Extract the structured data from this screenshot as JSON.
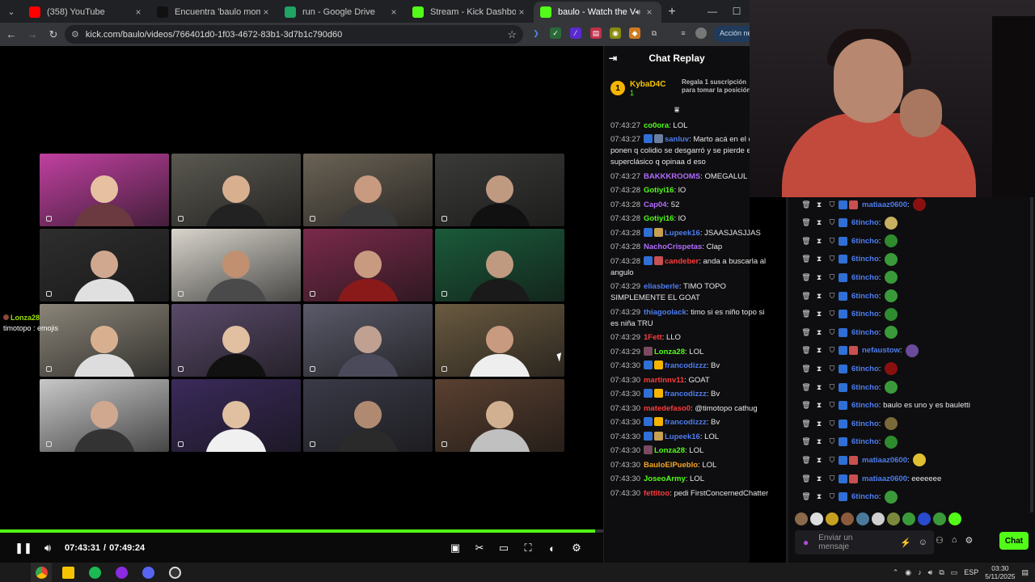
{
  "tabs": [
    {
      "label": "(358) YouTube",
      "favicon_color": "#ff0000"
    },
    {
      "label": "Encuentra 'baulo momo' en TikTok",
      "favicon_color": "#111111"
    },
    {
      "label": "run - Google Drive",
      "favicon_color": "#1fa463"
    },
    {
      "label": "Stream - Kick Dashboard",
      "favicon_color": "#53fc18"
    },
    {
      "label": "baulo - Watch the VOD on Kick",
      "favicon_color": "#53fc18",
      "active": true
    }
  ],
  "address": {
    "url": "kick.com/baulo/videos/766401d0-1f03-4672-83b1-3d7b1c790d60",
    "action_label": "Acción necesaria"
  },
  "player": {
    "time_current": "07:43:31",
    "time_separator": "/",
    "time_total": "07:49:24",
    "progress": 0.987,
    "overlay": {
      "user": "Lonza28",
      "line2": "timotopo : emojis"
    }
  },
  "chat_replay": {
    "title": "Chat Replay",
    "pinned": {
      "rank": "1",
      "user": "KybaD4C",
      "sub_count": "1",
      "gift_line1": "Regala 1 suscripción",
      "gift_line2": "para tomar la posición"
    },
    "messages": [
      {
        "ts": "07:43:27",
        "user": "co0ora",
        "color": "#53fc18",
        "text": "LOL"
      },
      {
        "ts": "07:43:27",
        "user": "sanluv",
        "color": "#4d7df0",
        "text": "Marto acá en el chat ponen q colidio se desgarró y se pierde el superclásico q opinaa d eso",
        "badges": [
          "#2f6fd6",
          "#6a7fa0"
        ]
      },
      {
        "ts": "07:43:27",
        "user": "BAKKKROOMS",
        "color": "#b36bff",
        "text": "OMEGALUL"
      },
      {
        "ts": "07:43:28",
        "user": "Gotiyi16",
        "color": "#53fc18",
        "text": "lO"
      },
      {
        "ts": "07:43:28",
        "user": "Cap04",
        "color": "#b36bff",
        "text": "52"
      },
      {
        "ts": "07:43:28",
        "user": "Gotiyi16",
        "color": "#53fc18",
        "text": "lO"
      },
      {
        "ts": "07:43:28",
        "user": "Lupeek16",
        "color": "#4d7df0",
        "text": "JSAASJASJJAS",
        "badges": [
          "#2f6fd6",
          "#c8a050"
        ]
      },
      {
        "ts": "07:43:28",
        "user": "NachoCrispetas",
        "color": "#b36bff",
        "text": "Clap"
      },
      {
        "ts": "07:43:28",
        "user": "candeber",
        "color": "#ff3b3b",
        "text": "anda a buscarla al angulo",
        "badges": [
          "#2f6fd6",
          "#c85050"
        ]
      },
      {
        "ts": "07:43:29",
        "user": "eliasberle",
        "color": "#4d7df0",
        "text": "TIMO TOPO SIMPLEMENTE EL GOAT"
      },
      {
        "ts": "07:43:29",
        "user": "thiagoolack",
        "color": "#4d7df0",
        "text": "timo si es niño topo si es niña TRU"
      },
      {
        "ts": "07:43:29",
        "user": "1Fett",
        "color": "#ff3b3b",
        "text": "LLO"
      },
      {
        "ts": "07:43:29",
        "user": "Lonza28",
        "color": "#53fc18",
        "text": "LOL",
        "badges": [
          "#7a4a60"
        ]
      },
      {
        "ts": "07:43:30",
        "user": "francodizzz",
        "color": "#4d7df0",
        "text": "Bv",
        "badges": [
          "#2f6fd6",
          "#f5b400"
        ]
      },
      {
        "ts": "07:43:30",
        "user": "martinnv11",
        "color": "#ff3b3b",
        "text": "GOAT"
      },
      {
        "ts": "07:43:30",
        "user": "francodizzz",
        "color": "#4d7df0",
        "text": "Bv",
        "badges": [
          "#2f6fd6",
          "#f5b400"
        ]
      },
      {
        "ts": "07:43:30",
        "user": "matedefaso0",
        "color": "#ff3b3b",
        "text": "@timotopo cathug"
      },
      {
        "ts": "07:43:30",
        "user": "francodizzz",
        "color": "#4d7df0",
        "text": "Bv",
        "badges": [
          "#2f6fd6",
          "#f5b400"
        ]
      },
      {
        "ts": "07:43:30",
        "user": "Lupeek16",
        "color": "#4d7df0",
        "text": "LOL",
        "badges": [
          "#2f6fd6",
          "#c8a050"
        ]
      },
      {
        "ts": "07:43:30",
        "user": "Lonza28",
        "color": "#53fc18",
        "text": "LOL",
        "badges": [
          "#7a4a60"
        ]
      },
      {
        "ts": "07:43:30",
        "user": "BauloElPueblo",
        "color": "#f5a623",
        "text": "LOL"
      },
      {
        "ts": "07:43:30",
        "user": "JoseoArmy",
        "color": "#53fc18",
        "text": "LOL"
      },
      {
        "ts": "07:43:30",
        "user": "fettitoo",
        "color": "#ff3b3b",
        "text": "pedi FirstConcernedChatter"
      }
    ]
  },
  "side_chat": {
    "rows": [
      {
        "user": "matiaaz0600",
        "color": "#4d7df0",
        "text": "",
        "badge": "#c85050",
        "emote": "#8a1010"
      },
      {
        "user": "6tincho",
        "color": "#4d7df0",
        "text": "",
        "emote": "#c8b060"
      },
      {
        "user": "6tincho",
        "color": "#4d7df0",
        "text": "",
        "emote": "#2e8b2e"
      },
      {
        "user": "6tincho",
        "color": "#4d7df0",
        "text": "",
        "emote": "#3a9a3a"
      },
      {
        "user": "6tincho",
        "color": "#4d7df0",
        "text": "",
        "emote": "#3a9a3a"
      },
      {
        "user": "6tincho",
        "color": "#4d7df0",
        "text": "",
        "emote": "#3a9a3a"
      },
      {
        "user": "6tincho",
        "color": "#4d7df0",
        "text": "",
        "emote": "#2e8b2e"
      },
      {
        "user": "6tincho",
        "color": "#4d7df0",
        "text": "",
        "emote": "#3a9a3a"
      },
      {
        "user": "nefaustow",
        "color": "#4d7df0",
        "text": "",
        "badge": "#c85050",
        "emote": "#6a4a9a"
      },
      {
        "user": "6tincho",
        "color": "#4d7df0",
        "text": "",
        "emote": "#8a1010"
      },
      {
        "user": "6tincho",
        "color": "#4d7df0",
        "text": "",
        "emote": "#3a9a3a"
      },
      {
        "user": "6tincho",
        "color": "#4d7df0",
        "text": "baulo es uno y es bauletti",
        "emote": ""
      },
      {
        "user": "6tincho",
        "color": "#4d7df0",
        "text": "",
        "emote": "#7a6a3a"
      },
      {
        "user": "6tincho",
        "color": "#4d7df0",
        "text": "",
        "emote": "#2e8b2e"
      },
      {
        "user": "matiaaz0600",
        "color": "#4d7df0",
        "text": "",
        "badge": "#c85050",
        "emote": "#e0c030"
      },
      {
        "user": "matiaaz0600",
        "color": "#4d7df0",
        "text": "eeeeeee",
        "badge": "#c85050",
        "emote": ""
      },
      {
        "user": "6tincho",
        "color": "#4d7df0",
        "text": "",
        "emote": "#3a9a3a"
      }
    ],
    "input_placeholder_1": "Enviar un",
    "input_placeholder_2": "mensaje",
    "chat_button": "Chat"
  },
  "taskbar": {
    "lang": "ESP",
    "time": "03:30",
    "date": "5/11/2025"
  },
  "colors": {
    "kick_green": "#53fc18",
    "bg": "#0e0e10"
  }
}
